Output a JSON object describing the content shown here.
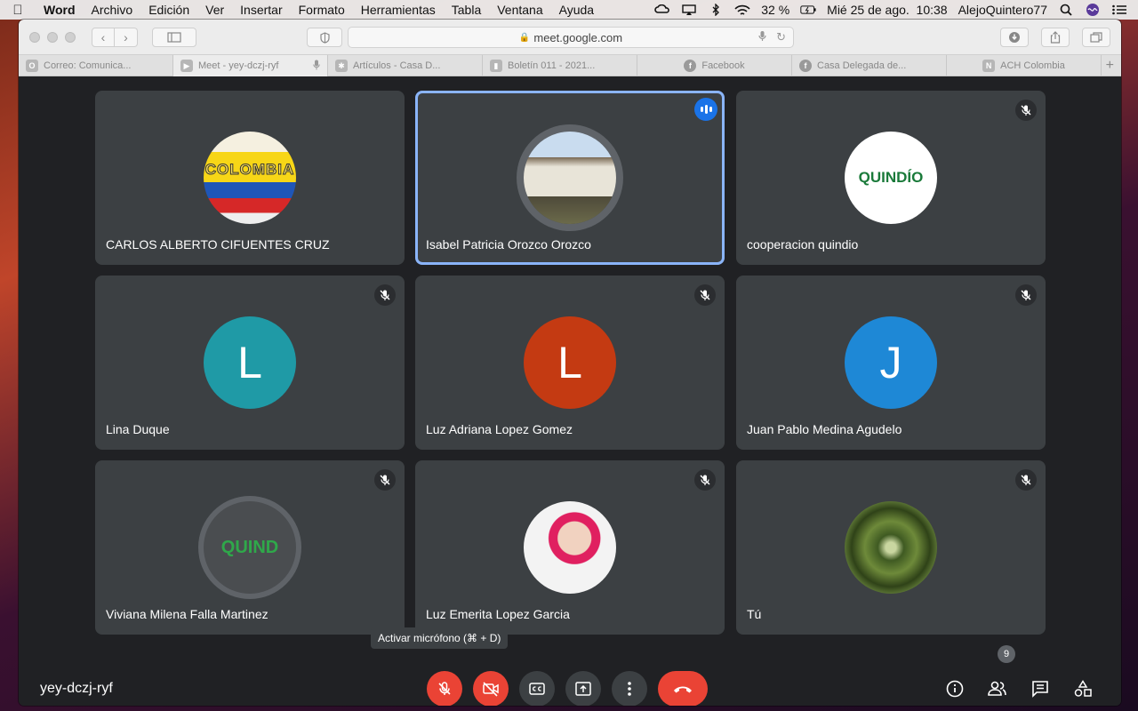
{
  "menubar": {
    "apple_icon": "apple-icon",
    "app_name": "Word",
    "items": [
      "Archivo",
      "Edición",
      "Ver",
      "Insertar",
      "Formato",
      "Herramientas",
      "Tabla",
      "Ventana",
      "Ayuda"
    ],
    "battery": "32 %",
    "datetime": "Mié 25 de ago.  10:38",
    "user": "AlejoQuintero77"
  },
  "browser": {
    "url": "meet.google.com",
    "tabs": [
      {
        "label": "Correo: Comunica...",
        "icon": "outlook-icon",
        "glyph": "O"
      },
      {
        "label": "Meet - yey-dczj-ryf",
        "icon": "meet-icon",
        "glyph": "▶",
        "active": true
      },
      {
        "label": "Artículos - Casa D...",
        "icon": "joomla-icon",
        "glyph": "✱"
      },
      {
        "label": "Boletín 011 - 2021...",
        "icon": "doc-icon",
        "glyph": "▮"
      },
      {
        "label": "Facebook",
        "icon": "facebook-icon",
        "glyph": "f"
      },
      {
        "label": "Casa Delegada de...",
        "icon": "facebook-icon",
        "glyph": "f"
      },
      {
        "label": "ACH Colombia",
        "icon": "notion-icon",
        "glyph": "N"
      }
    ]
  },
  "meet": {
    "participants": [
      {
        "name": "CARLOS ALBERTO CIFUENTES CRUZ",
        "avatar_type": "image",
        "avatar_text": "COLOMBIA",
        "muted": false,
        "speaking": false
      },
      {
        "name": "Isabel Patricia Orozco Orozco",
        "avatar_type": "image",
        "avatar_text": "",
        "muted": false,
        "speaking": true
      },
      {
        "name": "cooperacion quindio",
        "avatar_type": "image",
        "avatar_text": "QUINDÍO",
        "muted": true,
        "speaking": false
      },
      {
        "name": "Lina Duque",
        "avatar_type": "initial",
        "avatar_text": "L",
        "avatar_color": "#1f9aa6",
        "muted": true,
        "speaking": false
      },
      {
        "name": "Luz Adriana Lopez Gomez",
        "avatar_type": "initial",
        "avatar_text": "L",
        "avatar_color": "#c43a12",
        "muted": true,
        "speaking": false
      },
      {
        "name": "Juan Pablo Medina Agudelo",
        "avatar_type": "initial",
        "avatar_text": "J",
        "avatar_color": "#1e88d6",
        "muted": true,
        "speaking": false
      },
      {
        "name": "Viviana Milena Falla Martinez",
        "avatar_type": "image",
        "avatar_text": "QUIND",
        "muted": true,
        "speaking": false
      },
      {
        "name": "Luz Emerita Lopez Garcia",
        "avatar_type": "image",
        "avatar_text": "",
        "muted": true,
        "speaking": false
      },
      {
        "name": "Tú",
        "avatar_type": "image",
        "avatar_text": "",
        "muted": true,
        "speaking": false
      }
    ],
    "meeting_code": "yey-dczj-ryf",
    "tooltip": "Activar micrófono (⌘ + D)",
    "participant_count": "9",
    "colors": {
      "accent": "#8ab4f8",
      "danger": "#ea4335",
      "tile": "#3c4043",
      "background": "#202124"
    }
  }
}
